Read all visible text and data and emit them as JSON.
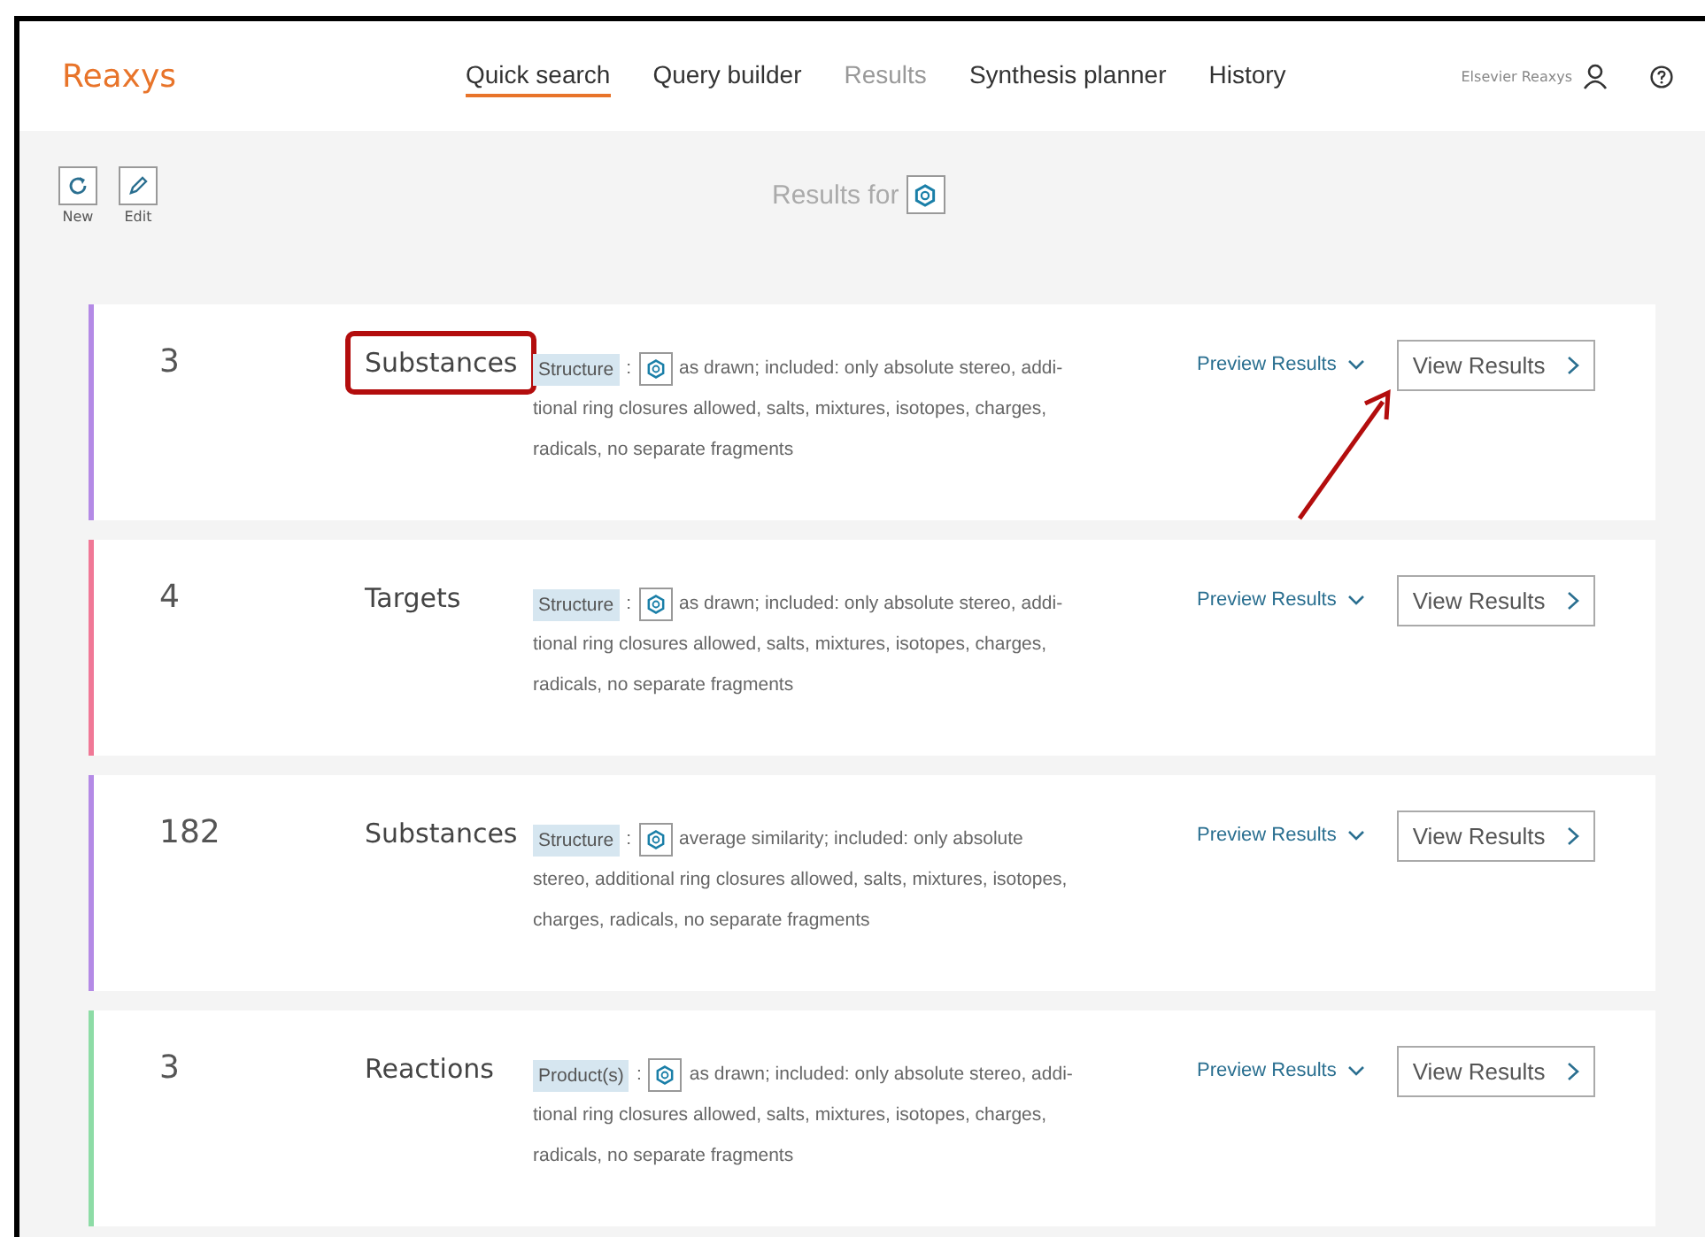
{
  "header": {
    "logo": "Reaxys",
    "nav": [
      {
        "label": "Quick search",
        "selected": true,
        "disabled": false
      },
      {
        "label": "Query builder",
        "selected": false,
        "disabled": false
      },
      {
        "label": "Results",
        "selected": false,
        "disabled": true
      },
      {
        "label": "Synthesis planner",
        "selected": false,
        "disabled": false
      },
      {
        "label": "History",
        "selected": false,
        "disabled": false
      }
    ],
    "account": "Elsevier Reaxys"
  },
  "toolbar": {
    "tools": [
      {
        "kind": "refresh",
        "label": "New"
      },
      {
        "kind": "edit",
        "label": "Edit"
      }
    ],
    "title": "Results for"
  },
  "results": [
    {
      "count": "3",
      "type": "Substances",
      "color": "#b48ae6",
      "highlighted": true,
      "arrow": true,
      "tag": "Structure",
      "separator": ":",
      "criteria_lines": [
        "as drawn; included: only absolute stereo, addi-",
        "tional ring closures allowed, salts, mixtures, isotopes, charges,",
        "radicals, no separate fragments"
      ],
      "preview": "Preview Results",
      "view": "View Results"
    },
    {
      "count": "4",
      "type": "Targets",
      "color": "#f07896",
      "highlighted": false,
      "arrow": false,
      "tag": "Structure",
      "separator": ":",
      "criteria_lines": [
        "as drawn; included: only absolute stereo, addi-",
        "tional ring closures allowed, salts, mixtures, isotopes, charges,",
        "radicals, no separate fragments"
      ],
      "preview": "Preview Results",
      "view": "View Results"
    },
    {
      "count": "182",
      "type": "Substances",
      "color": "#b48ae6",
      "highlighted": false,
      "arrow": false,
      "tag": "Structure",
      "separator": ":",
      "criteria_lines": [
        "average similarity; included: only absolute",
        "stereo, additional ring closures allowed, salts, mixtures, isotopes,",
        "charges, radicals, no separate fragments"
      ],
      "preview": "Preview Results",
      "view": "View Results"
    },
    {
      "count": "3",
      "type": "Reactions",
      "color": "#8ddca6",
      "highlighted": false,
      "arrow": false,
      "tag": "Product(s)",
      "separator": ":",
      "criteria_lines": [
        "as drawn; included: only absolute stereo, addi-",
        "tional ring closures allowed, salts, mixtures, isotopes, charges,",
        "radicals, no separate fragments"
      ],
      "preview": "Preview Results",
      "view": "View Results"
    }
  ]
}
